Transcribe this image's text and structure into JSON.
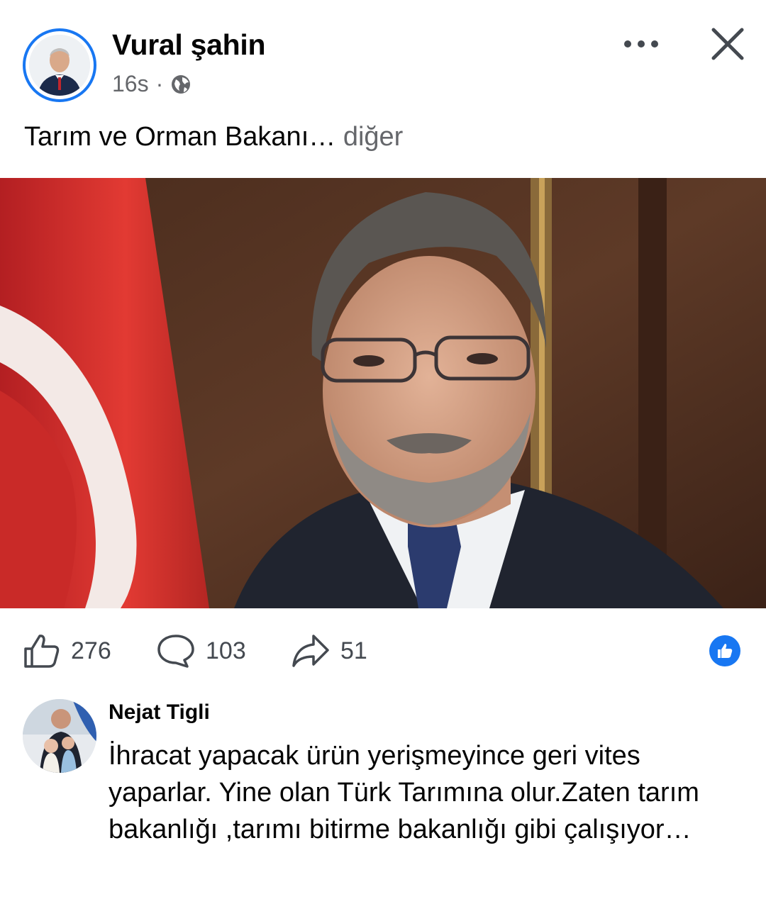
{
  "post": {
    "author": "Vural şahin",
    "time": "16s",
    "separator": "·",
    "visibility_icon": "globe-icon",
    "caption": "Tarım ve Orman Bakanı…",
    "see_more": "diğer"
  },
  "stats": {
    "likes": "276",
    "comments": "103",
    "shares": "51"
  },
  "comment": {
    "author": "Nejat Tigli",
    "text": "İhracat yapacak ürün yerişmeyince geri vites yaparlar. Yine olan Türk Tarımına olur.Zaten tarım bakanlığı  ,tarımı bitirme bakanlığı gibi çalışıyor…"
  },
  "colors": {
    "accent": "#1877f2",
    "secondary_text": "#65676b",
    "flag_red": "#d62b2b"
  }
}
